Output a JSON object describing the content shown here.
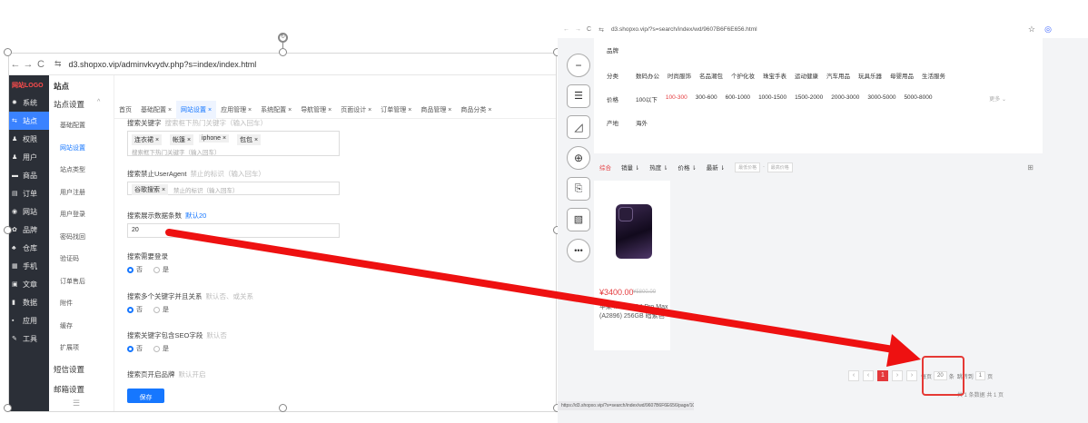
{
  "left": {
    "url": "d3.shopxo.vip/adminvkvydv.php?s=index/index.html",
    "logo": "网站LOGO",
    "sidebar": [
      {
        "label": "站点"
      },
      {
        "label": "系统",
        "icon": "gear-icon"
      },
      {
        "label": "站点",
        "icon": "sliders-icon",
        "active": true
      },
      {
        "label": "权限",
        "icon": "user-icon"
      },
      {
        "label": "用户",
        "icon": "user-icon"
      },
      {
        "label": "商品",
        "icon": "box-icon"
      },
      {
        "label": "订单",
        "icon": "list-icon"
      },
      {
        "label": "网站",
        "icon": "globe-icon"
      },
      {
        "label": "品牌",
        "icon": "tag-icon"
      },
      {
        "label": "仓库",
        "icon": "warehouse-icon"
      },
      {
        "label": "手机",
        "icon": "grid-icon"
      },
      {
        "label": "文章",
        "icon": "doc-icon"
      },
      {
        "label": "数据",
        "icon": "chart-icon"
      },
      {
        "label": "应用",
        "icon": "apps-icon"
      },
      {
        "label": "工具",
        "icon": "wrench-icon"
      }
    ],
    "menu2": {
      "head": "站点",
      "group": "站点设置",
      "items": [
        "基础配置",
        "网站设置",
        "站点类型",
        "用户注册",
        "用户登录",
        "密码找回",
        "验证码",
        "订单售后",
        "附件",
        "缓存",
        "扩展项"
      ],
      "groups_bottom": [
        "短信设置",
        "邮箱设置"
      ]
    },
    "tabs": [
      "首页",
      "基础配置 ×",
      "网站设置 ×",
      "应用管理 ×",
      "系统配置 ×",
      "导航管理 ×",
      "页面设计 ×",
      "订单管理 ×",
      "商品管理 ×",
      "商品分类 ×"
    ],
    "form": {
      "kw_label": "搜索关键字",
      "kw_hint": "搜索框下热门关键字（输入回车）",
      "kw_tags": [
        "连衣裙 ×",
        "帐篷 ×",
        "iphone ×",
        "包包 ×"
      ],
      "kw_placeholder": "搜索框下热门关键字（输入回车）",
      "ua_label": "搜索禁止UserAgent",
      "ua_hint": "禁止的标识（输入回车）",
      "ua_tags": [
        "谷歌搜索 ×"
      ],
      "ua_placeholder": "禁止的标识（输入回车）",
      "count_label": "搜索展示数据条数",
      "count_hint": "默认20",
      "count_value": "20",
      "login_label": "搜索需要登录",
      "multi_label": "搜索多个关键字并且关系",
      "multi_hint": "默认否、或关系",
      "seo_label": "搜索关键字包含SEO字段",
      "seo_hint": "默认否",
      "brand_label": "搜索页开启品牌",
      "brand_hint": "默认开启",
      "radio_no": "否",
      "radio_yes": "是",
      "save": "保存"
    }
  },
  "right": {
    "url": "d3.shopxo.vip/?s=search/index/wd/9607B6F6E656.html",
    "brand_label": "品牌",
    "category_label": "分类",
    "categories": [
      "数码办公",
      "时尚服饰",
      "名品潮包",
      "个护化妆",
      "珠宝手表",
      "运动健康",
      "汽车用品",
      "玩具乐器",
      "母婴用品",
      "生活服务"
    ],
    "price_label": "价格",
    "prices": [
      "100以下",
      "100-300",
      "300-600",
      "600-1000",
      "1000-1500",
      "1500-2000",
      "2000-3000",
      "3000-5000",
      "5000-8000"
    ],
    "more": "更多 ⌄",
    "origin_label": "产地",
    "origins": [
      "海外"
    ],
    "sorts": [
      "综合",
      "销量 ⇂",
      "热度 ⇂",
      "价格 ⇂",
      "最新 ⇂"
    ],
    "min_price_ph": "最低价格",
    "max_price_ph": "最高价格",
    "product": {
      "price": "¥3400.00",
      "old_price": "¥5800.00",
      "title": "苹果 iPhone 14 Pro Max (A2896) 256GB 暗紫色"
    },
    "pager": {
      "prev2": "‹",
      "prev": "‹",
      "current": "1",
      "next": "›",
      "next2": "›",
      "per_label": "每页",
      "per_value": "20",
      "per_unit": "条",
      "jump_label": "跳转到",
      "jump_value": "1",
      "jump_unit": "页",
      "stats": "共 1 条数据  共 1 页"
    },
    "status_url": "https://d3.shopxo.vip/?s=search/index/wd/9607B6F6E656/page/10.html"
  },
  "colors": {
    "accent": "#1677ff",
    "red": "#e4393c",
    "sidebar": "#2b2f37"
  }
}
